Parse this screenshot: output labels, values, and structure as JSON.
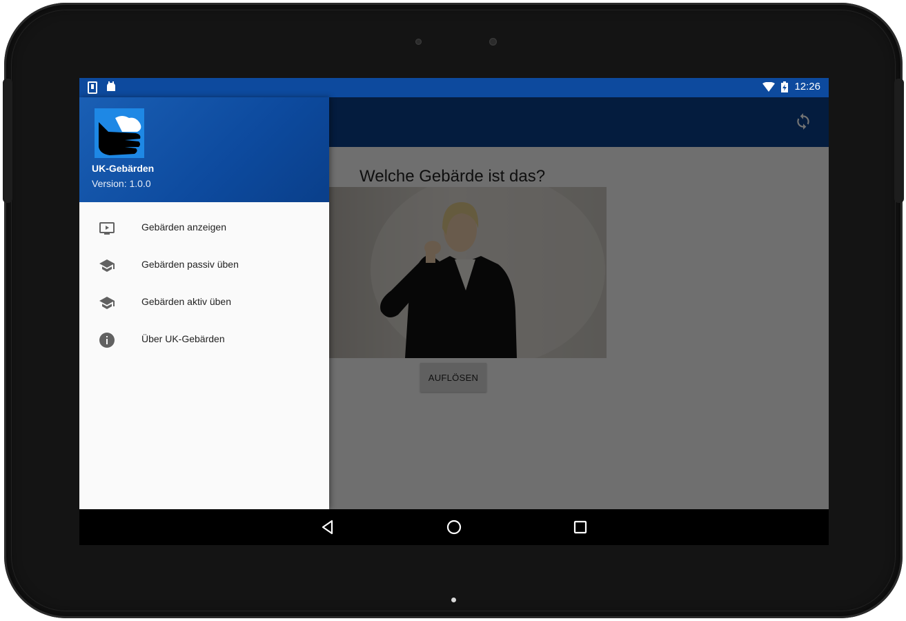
{
  "statusbar": {
    "time": "12:26"
  },
  "drawer": {
    "app_name": "UK-Gebärden",
    "version": "Version: 1.0.0",
    "items": [
      {
        "label": "Gebärden anzeigen",
        "icon": "video-icon"
      },
      {
        "label": "Gebärden passiv üben",
        "icon": "school-icon"
      },
      {
        "label": "Gebärden aktiv üben",
        "icon": "school-icon"
      },
      {
        "label": "Über UK-Gebärden",
        "icon": "info-icon"
      }
    ]
  },
  "main": {
    "question": "Welche Gebärde ist das?",
    "resolve_button": "AUFLÖSEN"
  },
  "colors": {
    "primary": "#0d4a9e",
    "primary_dark": "#0a3f8a",
    "drawer_bg": "#fafafa"
  }
}
